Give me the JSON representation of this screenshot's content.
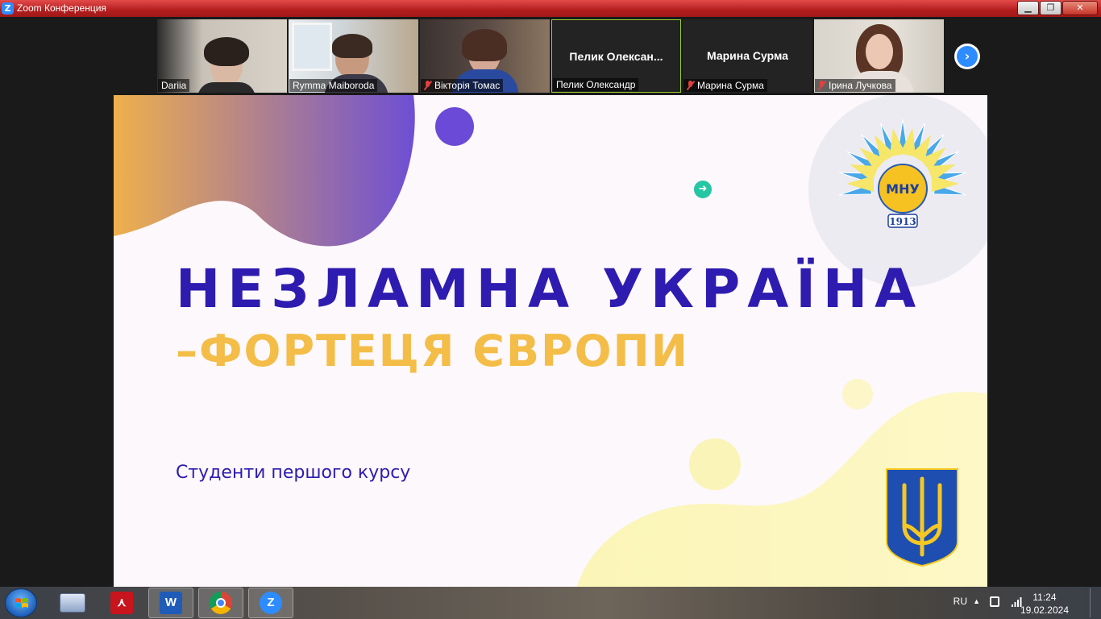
{
  "window": {
    "title": "Zoom Конференция",
    "app_icon": "zoom-z-icon",
    "btn_minimize": "▁",
    "btn_restore": "❐",
    "btn_close": "✕"
  },
  "gallery": {
    "participants": [
      {
        "name": "Dariia",
        "muted": false,
        "video": true
      },
      {
        "name": "Rymma Maiboroda",
        "muted": false,
        "video": true
      },
      {
        "name": "Вікторія Томас",
        "muted": true,
        "video": true
      },
      {
        "name": "Пелик Олександр",
        "display_name": "Пелик  Олексан...",
        "muted": false,
        "video": false,
        "active_speaker": true
      },
      {
        "name": "Марина Сурма",
        "display_name": "Марина Сурма",
        "muted": true,
        "video": false
      },
      {
        "name": "Ірина Лучкова",
        "muted": true,
        "video": true
      }
    ],
    "next_icon": "chevron-right-icon",
    "next_glyph": "›"
  },
  "slide": {
    "title_line1": "НЕЗЛАМНА УКРАЇНА",
    "title_line2": "–ФОРТЕЦЯ ЄВРОПИ",
    "subtitle": "Студенти першого курсу",
    "logo_text": "МНУ",
    "logo_year": "1913",
    "colors": {
      "title": "#2e1bb0",
      "accent": "#f3bd48",
      "gradient_start": "#f0b04a",
      "gradient_end": "#7050d0"
    }
  },
  "taskbar": {
    "apps": [
      "start-orb",
      "keyboard-app",
      "acrobat-reader",
      "word",
      "chrome",
      "zoom"
    ],
    "word_glyph": "W",
    "zoom_glyph": "Z",
    "tray": {
      "language": "RU",
      "expand_glyph": "▲",
      "time": "11:24",
      "date": "19.02.2024"
    }
  }
}
